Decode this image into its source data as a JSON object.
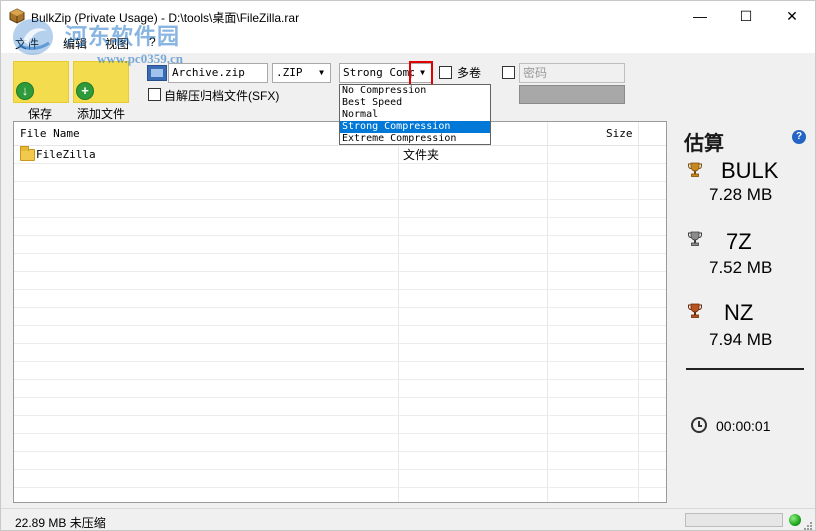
{
  "window": {
    "title": "BulkZip (Private Usage)  - D:\\tools\\桌面\\FileZilla.rar",
    "minimize_label": "—",
    "maximize_label": "☐",
    "close_label": "✕"
  },
  "watermark": {
    "title": "河东软件园",
    "url": "www.pc0359.cn"
  },
  "menu": {
    "items": [
      {
        "label": "文件"
      },
      {
        "label": "编辑"
      },
      {
        "label": "视图"
      },
      {
        "label": "?"
      }
    ]
  },
  "toolbar": {
    "save_label": "保存",
    "save_icon": "↓",
    "add_label": "添加文件",
    "add_icon": "+",
    "archive_name": "Archive.zip",
    "format": ".ZIP",
    "compression_value": "Strong Compression",
    "multi_volume_label": "多卷",
    "password_placeholder": "密码",
    "sfx_label": "自解压归档文件(SFX)"
  },
  "compression_dropdown": {
    "options": [
      {
        "label": "No Compression",
        "selected": false
      },
      {
        "label": "Best Speed",
        "selected": false
      },
      {
        "label": "Normal",
        "selected": false
      },
      {
        "label": "Strong Compression",
        "selected": true
      },
      {
        "label": "Extreme Compression",
        "selected": false
      }
    ]
  },
  "file_list": {
    "columns": [
      "File Name",
      "",
      "",
      "Size"
    ],
    "rows": [
      {
        "name": "FileZilla",
        "type": "文件夹",
        "size": ""
      }
    ]
  },
  "estimate": {
    "title": "估算",
    "help_icon": "?",
    "items": [
      {
        "name": "BULK",
        "size": "7.28 MB",
        "trophy": "gold-trophy-icon",
        "color": "#c9881d"
      },
      {
        "name": "7Z",
        "size": "7.52 MB",
        "trophy": "silver-trophy-icon",
        "color": "#8c8c8c"
      },
      {
        "name": "NZ",
        "size": "7.94 MB",
        "trophy": "bronze-trophy-icon",
        "color": "#b8521f"
      }
    ],
    "time": "00:00:01"
  },
  "status": {
    "text": "22.89 MB 未压缩",
    "progress": 0
  },
  "colors": {
    "accent": "#0078d7",
    "toolbar_button": "#f3dc4d",
    "highlight_box": "#e30000",
    "status_led": "#1ea51e"
  }
}
